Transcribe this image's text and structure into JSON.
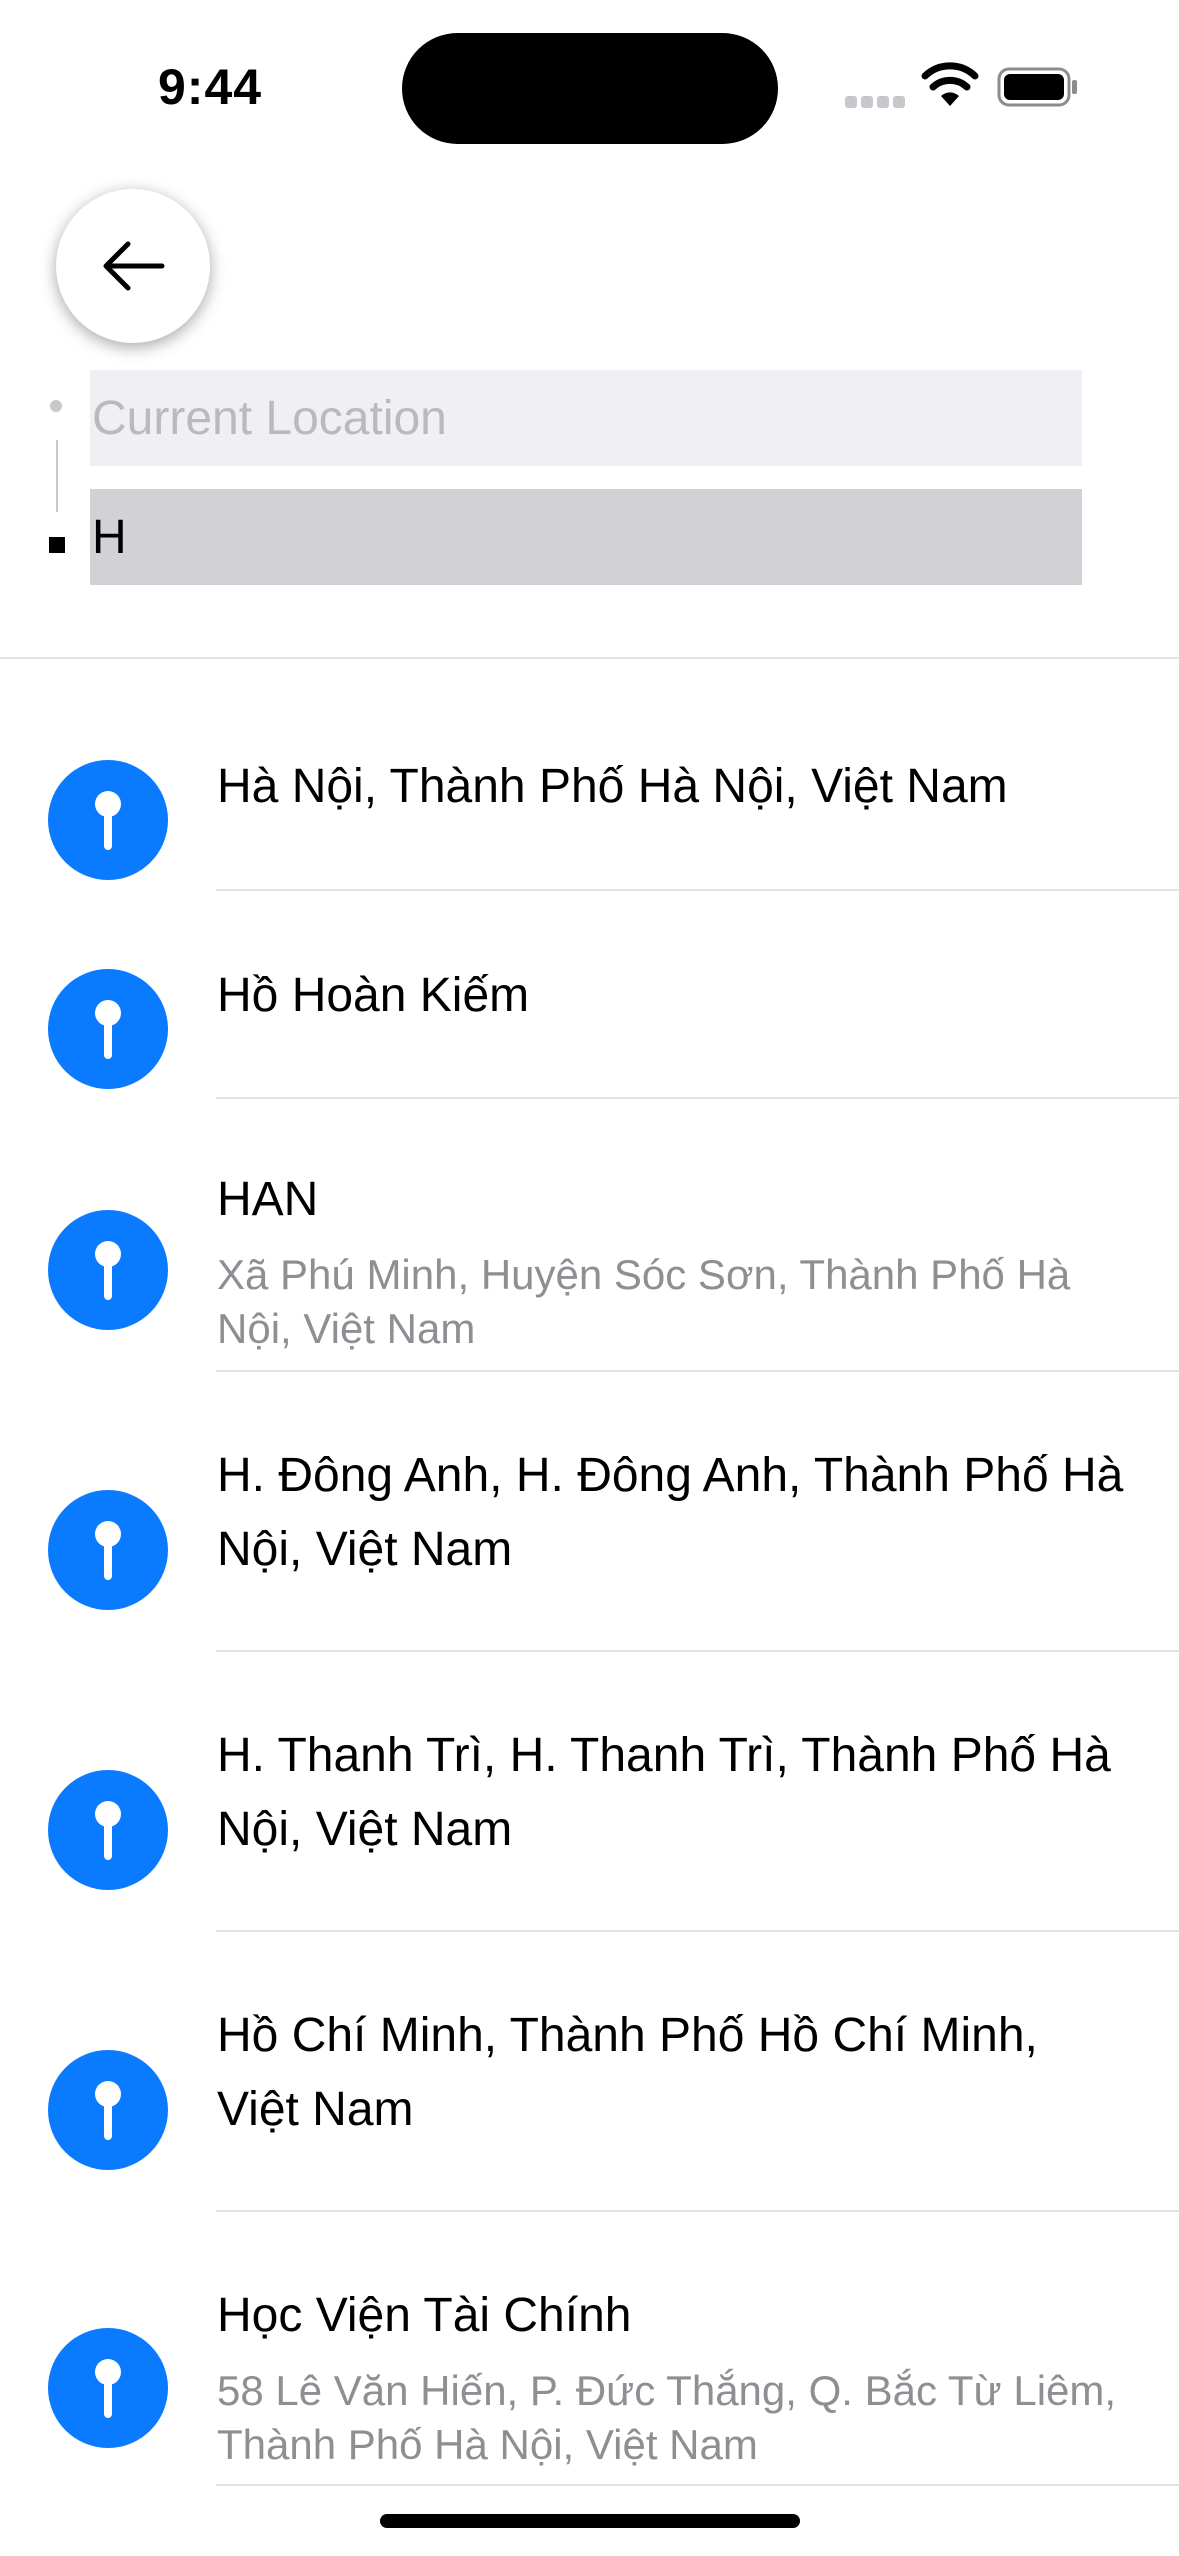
{
  "status_bar": {
    "time": "9:44"
  },
  "search": {
    "origin_placeholder": "Current Location",
    "origin_value": "",
    "destination_value": "H"
  },
  "results": [
    {
      "title": "Hà Nội, Thành Phố Hà Nội, Việt Nam",
      "subtitle": ""
    },
    {
      "title": "Hồ Hoàn Kiếm",
      "subtitle": ""
    },
    {
      "title": "HAN",
      "subtitle": "Xã Phú Minh, Huyện Sóc Sơn, Thành Phố Hà Nội, Việt Nam"
    },
    {
      "title": "H. Đông Anh, H. Đông Anh, Thành Phố Hà Nội, Việt Nam",
      "subtitle": ""
    },
    {
      "title": "H. Thanh Trì, H. Thanh Trì, Thành Phố Hà Nội, Việt Nam",
      "subtitle": ""
    },
    {
      "title": "Hồ Chí Minh, Thành Phố Hồ Chí Minh, Việt Nam",
      "subtitle": ""
    },
    {
      "title": "Học Viện Tài Chính",
      "subtitle": "58 Lê Văn Hiến, P. Đức Thắng, Q. Bắc Từ Liêm, Thành Phố Hà Nội, Việt Nam"
    }
  ],
  "colors": {
    "accent": "#0a7aff",
    "field_origin_bg": "#efeff4",
    "field_destination_bg": "#d1d1d6",
    "secondary_text": "#8e8e93"
  },
  "icons": {
    "back": "arrow-left-icon",
    "result": "map-pin-icon"
  }
}
